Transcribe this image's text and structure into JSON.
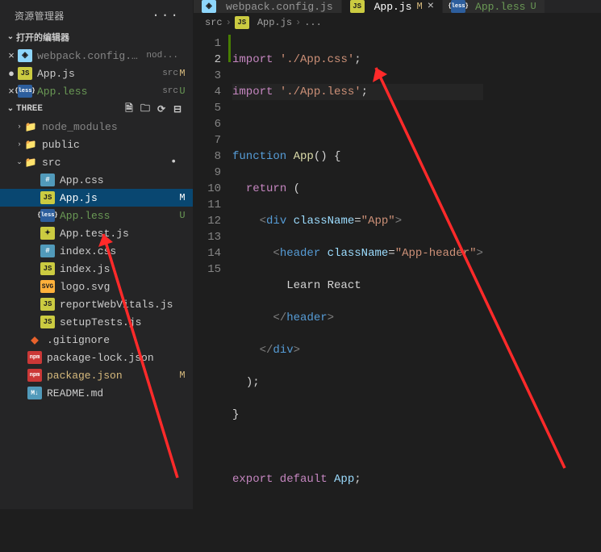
{
  "sidebar": {
    "title": "资源管理器",
    "openEditorsLabel": "打开的编辑器",
    "projectName": "THREE",
    "openEditors": [
      {
        "icon": "webpack",
        "label": "webpack.config.js",
        "meta": "nod...",
        "muted": true,
        "status": ""
      },
      {
        "icon": "js",
        "label": "App.js",
        "meta": "src",
        "status": "M",
        "dirty": true
      },
      {
        "icon": "less",
        "label": "App.less",
        "meta": "src",
        "status": "U",
        "green": true
      }
    ],
    "tree": [
      {
        "type": "folder",
        "chev": ">",
        "icon": "folder-green",
        "label": "node_modules",
        "muted": true,
        "indent": 1
      },
      {
        "type": "folder",
        "chev": ">",
        "icon": "folder-green",
        "label": "public",
        "indent": 1
      },
      {
        "type": "folder",
        "chev": "v",
        "icon": "folder-green",
        "label": "src",
        "dot": true,
        "indent": 1
      },
      {
        "type": "file",
        "icon": "css",
        "label": "App.css",
        "indent": 3
      },
      {
        "type": "file",
        "icon": "js",
        "label": "App.js",
        "status": "M",
        "active": true,
        "indent": 3
      },
      {
        "type": "file",
        "icon": "less",
        "label": "App.less",
        "status": "U",
        "green": true,
        "indent": 3
      },
      {
        "type": "file",
        "icon": "test",
        "label": "App.test.js",
        "indent": 3
      },
      {
        "type": "file",
        "icon": "css",
        "label": "index.css",
        "indent": 3
      },
      {
        "type": "file",
        "icon": "js",
        "label": "index.js",
        "indent": 3
      },
      {
        "type": "file",
        "icon": "svg",
        "label": "logo.svg",
        "indent": 3
      },
      {
        "type": "file",
        "icon": "js",
        "label": "reportWebVitals.js",
        "indent": 3
      },
      {
        "type": "file",
        "icon": "js",
        "label": "setupTests.js",
        "indent": 3
      },
      {
        "type": "file",
        "icon": "git",
        "label": ".gitignore",
        "indent": 2
      },
      {
        "type": "file",
        "icon": "npm",
        "label": "package-lock.json",
        "indent": 2
      },
      {
        "type": "file",
        "icon": "npm",
        "label": "package.json",
        "status": "M",
        "yellow": true,
        "indent": 2
      },
      {
        "type": "file",
        "icon": "md",
        "label": "README.md",
        "indent": 2
      }
    ]
  },
  "tabs": [
    {
      "icon": "webpack",
      "label": "webpack.config.js",
      "status": "",
      "active": false
    },
    {
      "icon": "js",
      "label": "App.js",
      "status": "M",
      "active": true,
      "close": true
    },
    {
      "icon": "less",
      "label": "App.less",
      "status": "U",
      "active": false,
      "green": true
    }
  ],
  "breadcrumb": {
    "root": "src",
    "icon": "js",
    "file": "App.js",
    "more": "..."
  },
  "code": {
    "lines": 15,
    "l1_kw": "import",
    "l1_str": "'./App.css'",
    "l1_semi": ";",
    "l2_kw": "import",
    "l2_str": "'./App.less'",
    "l2_semi": ";",
    "l4_kw": "function",
    "l4_fn": "App",
    "l4_rest": "() {",
    "l5_kw": "return",
    "l5_rest": " (",
    "l6_open": "<",
    "l6_tag": "div",
    "l6_attr": "className",
    "l6_eq": "=",
    "l6_val": "\"App\"",
    "l6_close": ">",
    "l7_open": "<",
    "l7_tag": "header",
    "l7_attr": "className",
    "l7_eq": "=",
    "l7_val": "\"App-header\"",
    "l7_close": ">",
    "l8_text": "Learn React",
    "l9_open": "</",
    "l9_tag": "header",
    "l9_close": ">",
    "l10_open": "</",
    "l10_tag": "div",
    "l10_close": ">",
    "l11": ");",
    "l12": "}",
    "l14_kw": "export default",
    "l14_id": "App",
    "l14_semi": ";"
  }
}
